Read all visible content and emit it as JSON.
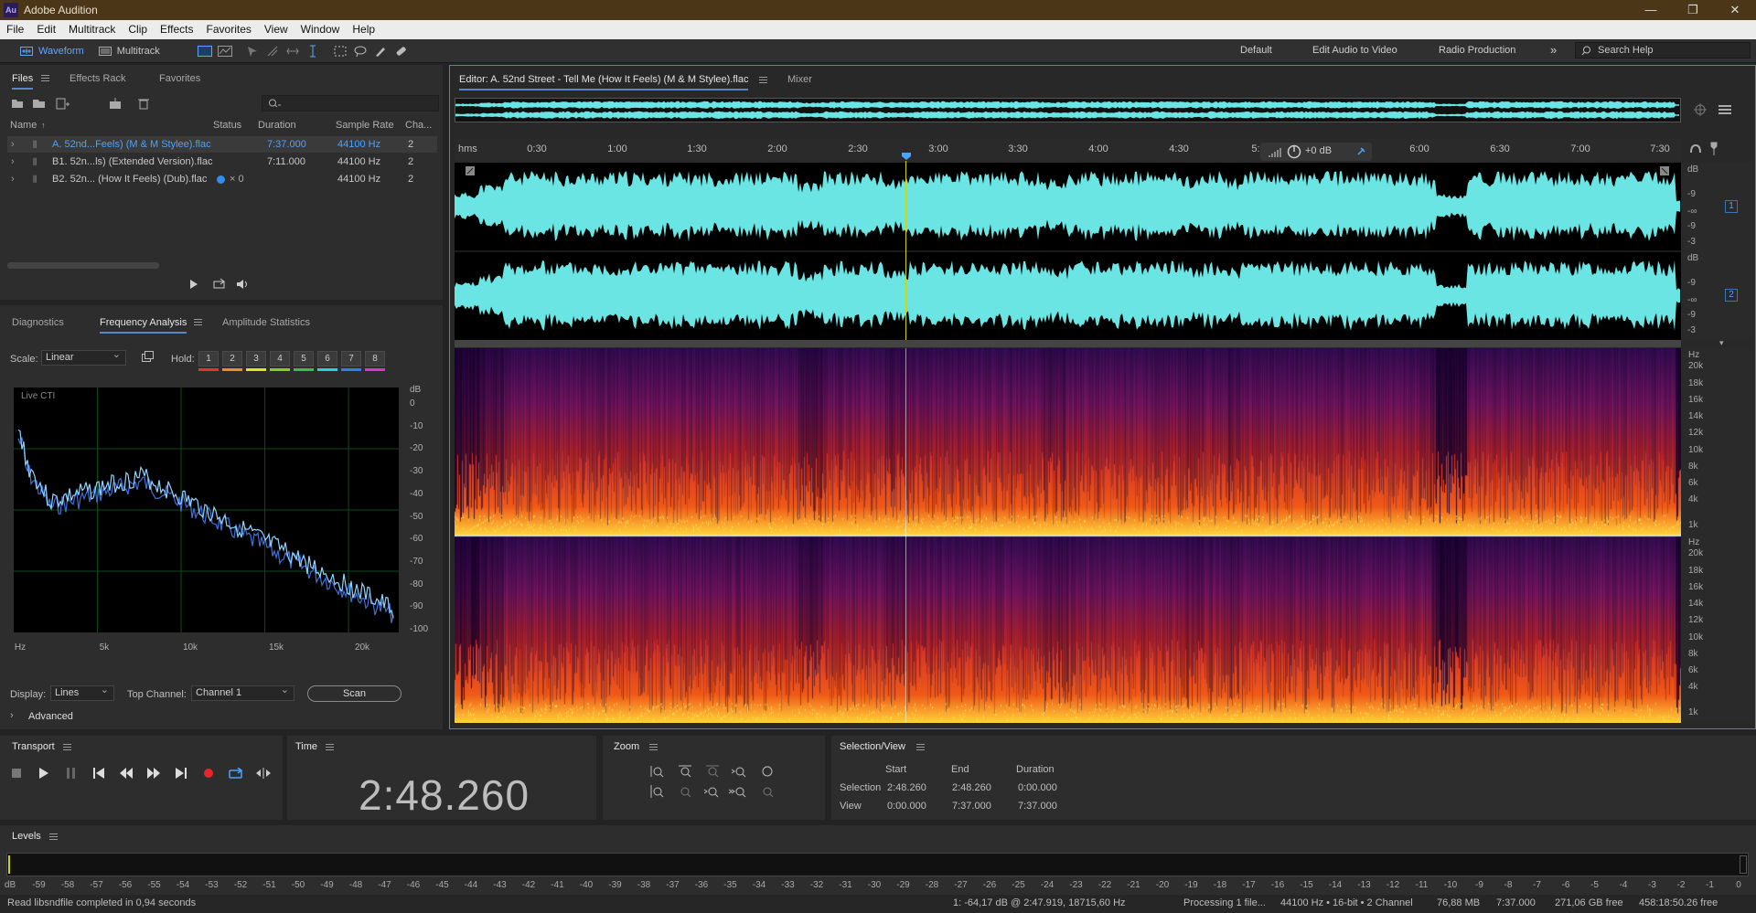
{
  "window": {
    "title": "Adobe Audition",
    "logo": "Au"
  },
  "menu": [
    "File",
    "Edit",
    "Multitrack",
    "Clip",
    "Effects",
    "Favorites",
    "View",
    "Window",
    "Help"
  ],
  "toolbar": {
    "waveform_label": "Waveform",
    "multitrack_label": "Multitrack",
    "workspaces": [
      "Default",
      "Edit Audio to Video",
      "Radio Production"
    ],
    "search_placeholder": "Search Help"
  },
  "files_panel": {
    "tabs": [
      "Files",
      "Effects Rack",
      "Favorites"
    ],
    "columns": [
      "Name",
      "Status",
      "Duration",
      "Sample Rate",
      "Cha..."
    ],
    "rows": [
      {
        "name": "A. 52nd...Feels) (M & M Stylee).flac",
        "status": "",
        "duration": "7:37.000",
        "rate": "44100 Hz",
        "ch": "2",
        "selected": true
      },
      {
        "name": "B1. 52n...ls) (Extended Version).flac",
        "status": "",
        "duration": "7:11.000",
        "rate": "44100 Hz",
        "ch": "2",
        "selected": false
      },
      {
        "name": "B2. 52n... (How It Feels) (Dub).flac",
        "status": "× 0",
        "duration": "",
        "rate": "44100 Hz",
        "ch": "2",
        "selected": false
      }
    ]
  },
  "analysis_panel": {
    "tabs": [
      "Diagnostics",
      "Frequency Analysis",
      "Amplitude Statistics"
    ],
    "scale_label": "Scale:",
    "scale_value": "Linear",
    "hold_label": "Hold:",
    "hold_buttons": [
      "1",
      "2",
      "3",
      "4",
      "5",
      "6",
      "7",
      "8"
    ],
    "hold_colors": [
      "#e8322c",
      "#f08b1c",
      "#e8e21c",
      "#7ed321",
      "#33c24a",
      "#22d3e0",
      "#2a7fe8",
      "#d930e0"
    ],
    "graph_label": "Live CTI",
    "y_unit": "dB",
    "y_labels": [
      "0",
      "-10",
      "-20",
      "-30",
      "-40",
      "-50",
      "-60",
      "-70",
      "-80",
      "-90",
      "-100"
    ],
    "x_labels": [
      "Hz",
      "5k",
      "10k",
      "15k",
      "20k"
    ],
    "display_label": "Display:",
    "display_value": "Lines",
    "top_channel_label": "Top Channel:",
    "top_channel_value": "Channel 1",
    "scan_label": "Scan",
    "advanced_label": "Advanced"
  },
  "editor": {
    "tab_label": "Editor: A. 52nd Street - Tell Me (How It Feels) (M & M Stylee).flac",
    "mixer_label": "Mixer",
    "ruler_unit": "hms",
    "ruler_labels": [
      "0:30",
      "1:00",
      "1:30",
      "2:00",
      "2:30",
      "3:00",
      "3:30",
      "4:00",
      "4:30",
      "5:",
      "6:00",
      "6:30",
      "7:00",
      "7:30"
    ],
    "gain_label": "+0 dB",
    "db_scale": [
      "dB",
      "-9",
      "-∞",
      "-9",
      "-3"
    ],
    "hz_scale": [
      "Hz",
      "20k",
      "18k",
      "16k",
      "14k",
      "12k",
      "10k",
      "8k",
      "6k",
      "4k",
      "1k"
    ],
    "channel_badges": [
      "1",
      "2"
    ]
  },
  "transport": {
    "title": "Transport"
  },
  "time_panel": {
    "title": "Time",
    "value": "2:48.260"
  },
  "zoom_panel": {
    "title": "Zoom"
  },
  "selection_view": {
    "title": "Selection/View",
    "headers": [
      "Start",
      "End",
      "Duration"
    ],
    "selection_label": "Selection",
    "selection": [
      "2:48.260",
      "2:48.260",
      "0:00.000"
    ],
    "view_label": "View",
    "view": [
      "0:00.000",
      "7:37.000",
      "7:37.000"
    ]
  },
  "levels": {
    "title": "Levels",
    "scale": [
      "dB",
      "-59",
      "-58",
      "-57",
      "-56",
      "-55",
      "-54",
      "-53",
      "-52",
      "-51",
      "-50",
      "-49",
      "-48",
      "-47",
      "-46",
      "-45",
      "-44",
      "-43",
      "-42",
      "-41",
      "-40",
      "-39",
      "-38",
      "-37",
      "-36",
      "-35",
      "-34",
      "-33",
      "-32",
      "-31",
      "-30",
      "-29",
      "-28",
      "-27",
      "-26",
      "-25",
      "-24",
      "-23",
      "-22",
      "-21",
      "-20",
      "-19",
      "-18",
      "-17",
      "-16",
      "-15",
      "-14",
      "-13",
      "-12",
      "-11",
      "-10",
      "-9",
      "-8",
      "-7",
      "-6",
      "-5",
      "-4",
      "-3",
      "-2",
      "-1",
      "0"
    ]
  },
  "status_bar": {
    "message": "Read libsndfile completed in 0,94 seconds",
    "cursor_info": "1: -64,17 dB @ 2:47.919, 18715,60 Hz",
    "processing": "Processing 1 file...",
    "format": "44100 Hz • 16-bit • 2 Channel",
    "size": "76,88 MB",
    "duration": "7:37.000",
    "free_space": "271,06 GB free",
    "free_time": "458:18:50.26 free"
  }
}
